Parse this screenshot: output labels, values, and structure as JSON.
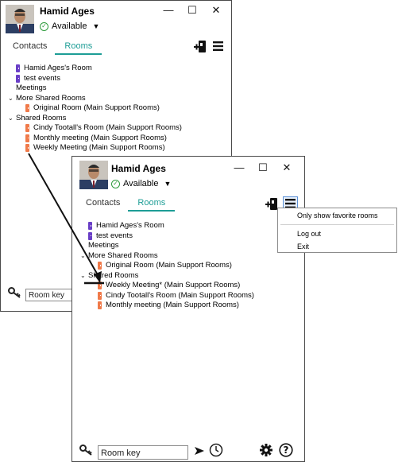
{
  "back_window": {
    "user_name": "Hamid Ages",
    "status": "Available",
    "window_controls": [
      "—",
      "☐",
      "✕"
    ],
    "tabs": [
      {
        "label": "Contacts"
      },
      {
        "label": "Rooms"
      }
    ],
    "active_tab": "Rooms",
    "rooms": [
      {
        "label": "Hamid Ages's Room",
        "kind": "room",
        "color": "purple"
      },
      {
        "label": "test events",
        "kind": "room",
        "color": "purple"
      },
      {
        "label": "Meetings",
        "kind": "header"
      },
      {
        "label": "More Shared Rooms",
        "kind": "group"
      },
      {
        "label": "Original Room (Main Support Rooms)",
        "kind": "room",
        "color": "orange"
      },
      {
        "label": "Shared Rooms",
        "kind": "group"
      },
      {
        "label": "Cindy Tootall's Room (Main Support Rooms)",
        "kind": "room",
        "color": "orange"
      },
      {
        "label": "Monthly meeting (Main Support Rooms)",
        "kind": "room",
        "color": "orange"
      },
      {
        "label": "Weekly Meeting (Main Support Rooms)",
        "kind": "room",
        "color": "orange"
      }
    ],
    "room_key_placeholder": "Room key"
  },
  "front_window": {
    "user_name": "Hamid Ages",
    "status": "Available",
    "window_controls": [
      "—",
      "☐",
      "✕"
    ],
    "tabs": [
      {
        "label": "Contacts"
      },
      {
        "label": "Rooms"
      }
    ],
    "active_tab": "Rooms",
    "rooms": [
      {
        "label": "Hamid Ages's Room",
        "kind": "room",
        "color": "purple"
      },
      {
        "label": "test events",
        "kind": "room",
        "color": "purple"
      },
      {
        "label": "Meetings",
        "kind": "header"
      },
      {
        "label": "More Shared Rooms",
        "kind": "group"
      },
      {
        "label": "Original Room (Main Support Rooms)",
        "kind": "room",
        "color": "orange"
      },
      {
        "label": "Shared Rooms",
        "kind": "group"
      },
      {
        "label": "Weekly Meeting* (Main Support Rooms)",
        "kind": "room",
        "color": "orange"
      },
      {
        "label": "Cindy Tootall's Room (Main Support Rooms)",
        "kind": "room",
        "color": "orange"
      },
      {
        "label": "Monthly meeting (Main Support Rooms)",
        "kind": "room",
        "color": "orange"
      }
    ],
    "room_key_placeholder": "Room key"
  },
  "menu": {
    "items": [
      "Only show favorite rooms",
      "Log out",
      "Exit"
    ]
  },
  "colors": {
    "accent": "#1d9d96",
    "status_green": "#2e9b3c",
    "room_purple": "#6a3fc7",
    "room_orange": "#f07a4a"
  },
  "icons": [
    "available-check-icon",
    "dropdown-caret-icon",
    "minimize-icon",
    "maximize-icon",
    "close-icon",
    "add-room-icon",
    "hamburger-menu-icon",
    "key-icon",
    "send-arrow-icon",
    "history-clock-icon",
    "settings-gear-icon",
    "help-icon",
    "chevron-down-icon",
    "room-door-icon"
  ]
}
